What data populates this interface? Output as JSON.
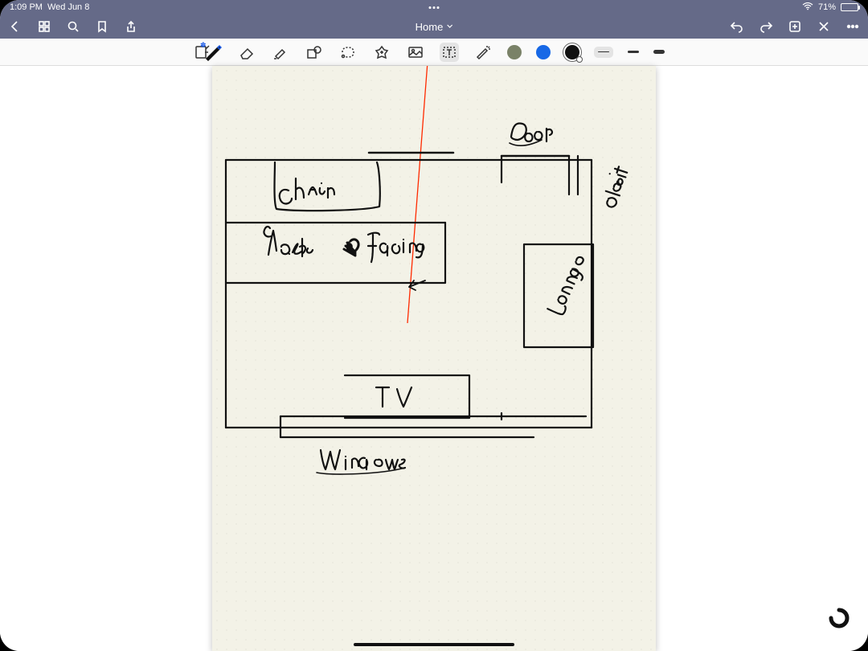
{
  "statusbar": {
    "time": "1:09 PM",
    "date": "Wed Jun 8",
    "battery_pct": "71%"
  },
  "navbar": {
    "title": "Home"
  },
  "tools": {
    "readonly": "read-only",
    "pen": "pen",
    "eraser": "eraser",
    "highlighter": "highlighter",
    "shape": "shape",
    "lasso": "lasso",
    "favorites": "favorites",
    "image": "image",
    "text": "text",
    "laser": "laser",
    "color_olive": "#7a8268",
    "color_blue": "#1768e6",
    "color_black": "#111111",
    "stroke_thin": "thin",
    "stroke_med": "medium",
    "stroke_thick": "thick"
  },
  "sketch_labels": {
    "door": "Door",
    "closet": "closet",
    "chair": "Chair",
    "desk": "desk",
    "facing": "facing",
    "lounge": "lounge",
    "tv": "tv",
    "windows": "Windows"
  }
}
